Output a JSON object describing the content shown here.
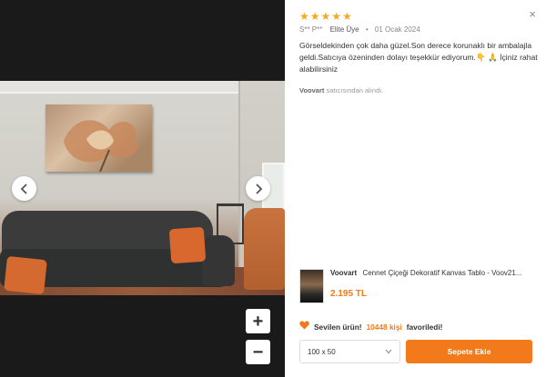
{
  "viewer": {
    "prev_icon": "chevron-left-icon",
    "next_icon": "chevron-right-icon",
    "zoom_in_label": "+",
    "zoom_out_label": "−"
  },
  "review": {
    "rating": 5,
    "stars": [
      "★",
      "★",
      "★",
      "★",
      "★"
    ],
    "author": "S** P**",
    "badge": "Elite Üye",
    "separator": "•",
    "date": "01 Ocak 2024",
    "text": "Görseldekinden çok daha güzel.Son derece korunaklı bir ambalajla geldi.Satıcıya özeninden dolayı teşekkür ediyorum.👇 🙏 İçiniz rahat alabilirsiniz",
    "seller_name": "Voovart",
    "seller_suffix": "satıcısından alındı."
  },
  "product": {
    "brand": "Voovart",
    "title": "Cennet Çiçeği Dekoratif Kanvas Tablo - Voov21...",
    "price": "2.195 TL"
  },
  "favorite": {
    "prefix": "Sevilen ürün!",
    "count": "10448 kişi",
    "suffix": "favoriledi!"
  },
  "purchase": {
    "selected_size": "100 x 50",
    "add_to_cart": "Sepete Ekle"
  },
  "close_label": "×",
  "colors": {
    "accent": "#f27a1a",
    "star": "#f6a91f",
    "viewer_bg": "#1a1a1a"
  }
}
